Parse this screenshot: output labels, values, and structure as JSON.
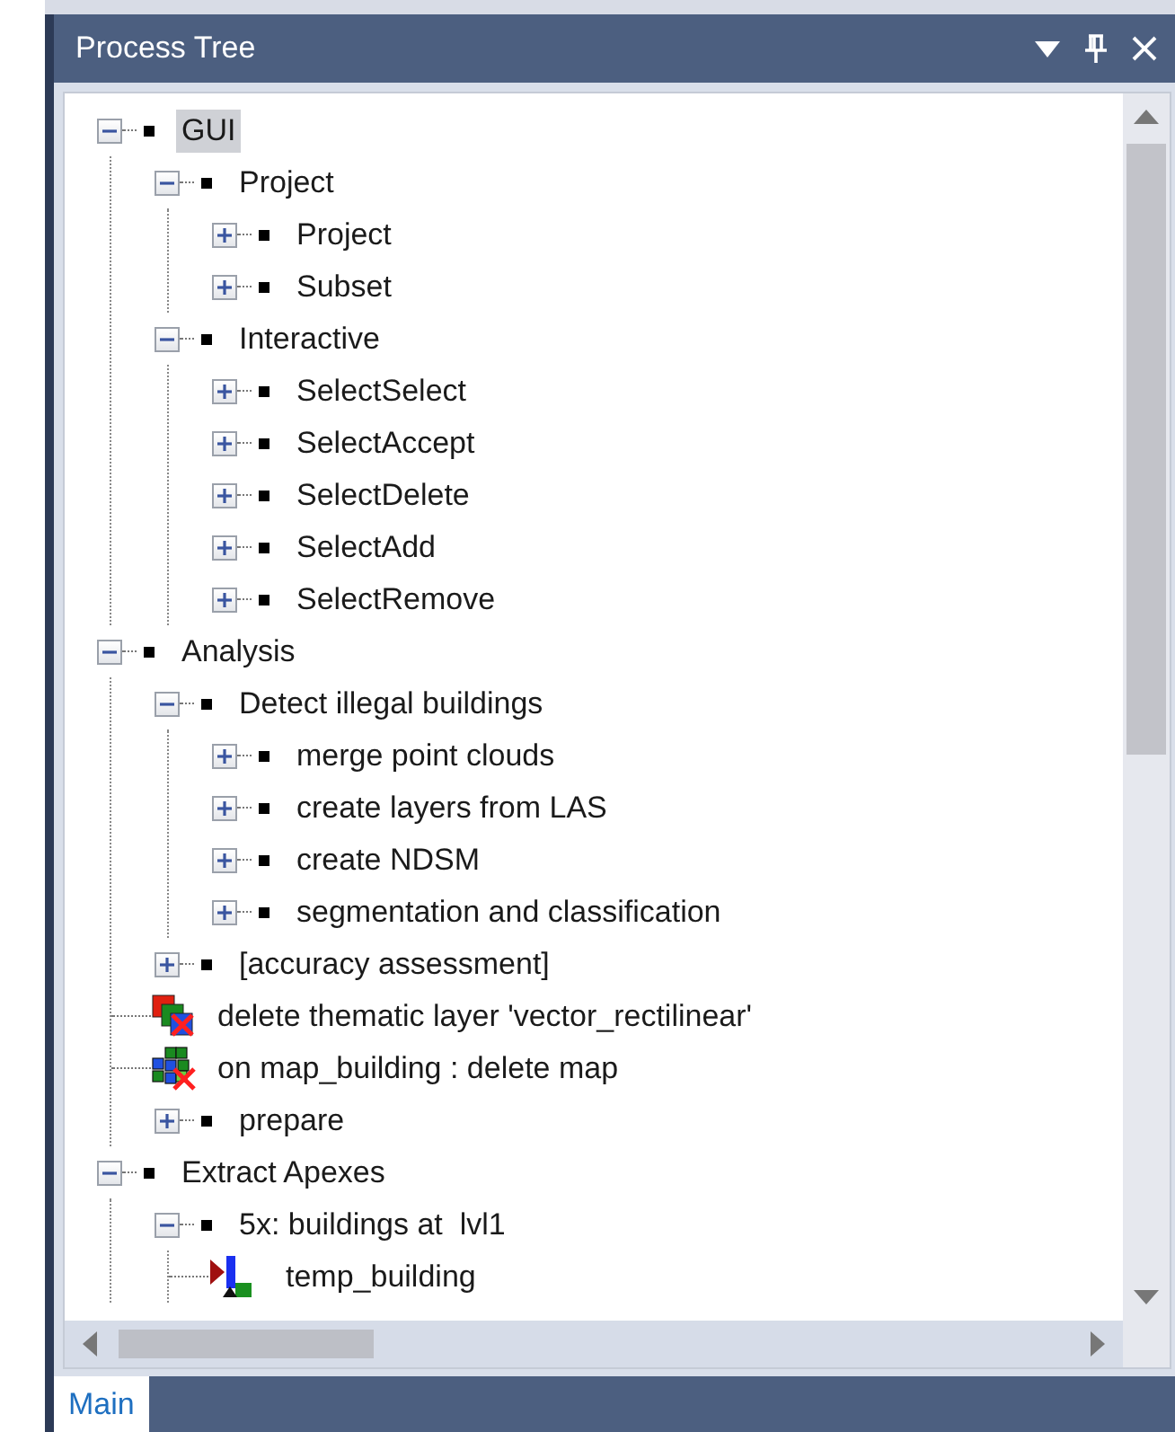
{
  "panel": {
    "title": "Process Tree"
  },
  "tree": [
    {
      "kind": "node",
      "label": "GUI",
      "selected": true,
      "expanded": true,
      "children": [
        {
          "kind": "node",
          "label": "Project",
          "selected": false,
          "expanded": true,
          "children": [
            {
              "kind": "node",
              "label": "Project",
              "selected": false,
              "expanded": false
            },
            {
              "kind": "node",
              "label": "Subset",
              "selected": false,
              "expanded": false
            }
          ]
        },
        {
          "kind": "node",
          "label": "Interactive",
          "selected": false,
          "expanded": true,
          "children": [
            {
              "kind": "node",
              "label": "SelectSelect",
              "selected": false,
              "expanded": false
            },
            {
              "kind": "node",
              "label": "SelectAccept",
              "selected": false,
              "expanded": false
            },
            {
              "kind": "node",
              "label": "SelectDelete",
              "selected": false,
              "expanded": false
            },
            {
              "kind": "node",
              "label": "SelectAdd",
              "selected": false,
              "expanded": false
            },
            {
              "kind": "node",
              "label": "SelectRemove",
              "selected": false,
              "expanded": false
            }
          ]
        }
      ]
    },
    {
      "kind": "node",
      "label": "Analysis",
      "selected": false,
      "expanded": true,
      "children": [
        {
          "kind": "node",
          "label": "Detect illegal buildings",
          "selected": false,
          "expanded": true,
          "children": [
            {
              "kind": "node",
              "label": "merge point clouds",
              "selected": false,
              "expanded": false
            },
            {
              "kind": "node",
              "label": "create layers from LAS",
              "selected": false,
              "expanded": false
            },
            {
              "kind": "node",
              "label": "create NDSM",
              "selected": false,
              "expanded": false
            },
            {
              "kind": "node",
              "label": "segmentation and classification",
              "selected": false,
              "expanded": false
            }
          ]
        },
        {
          "kind": "node",
          "label": "[accuracy assessment]",
          "selected": false,
          "expanded": false
        },
        {
          "kind": "delete-layer",
          "label": "delete thematic layer 'vector_rectilinear'",
          "selected": false
        },
        {
          "kind": "delete-map",
          "label": "on map_building : delete map",
          "selected": false
        },
        {
          "kind": "node",
          "label": "prepare",
          "selected": false,
          "expanded": false
        }
      ]
    },
    {
      "kind": "node",
      "label": "Extract Apexes",
      "selected": false,
      "expanded": true,
      "children": [
        {
          "kind": "node",
          "label": "5x: buildings at  lvl1",
          "selected": false,
          "expanded": true,
          "children": [
            {
              "kind": "variable",
              "label": "temp_building",
              "selected": false
            }
          ]
        }
      ]
    }
  ],
  "tabs": [
    {
      "label": "Main",
      "selected": true
    }
  ]
}
